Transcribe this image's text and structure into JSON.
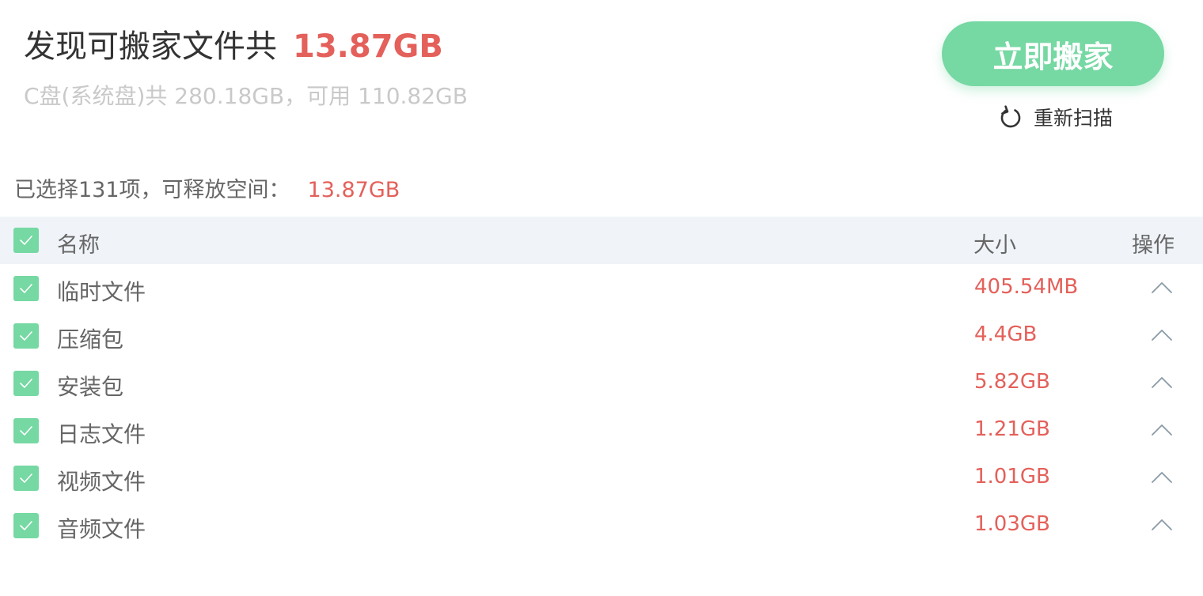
{
  "header": {
    "title": "发现可搬家文件共",
    "total_size": "13.87GB",
    "disk_info": "C盘(系统盘)共 280.18GB，可用 110.82GB",
    "move_button_label": "立即搬家",
    "rescan_label": "重新扫描"
  },
  "summary": {
    "prefix": "已选择131项，可释放空间：",
    "size": "13.87GB"
  },
  "table": {
    "columns": {
      "name": "名称",
      "size": "大小",
      "action": "操作"
    },
    "all_checked": true,
    "rows": [
      {
        "name": "临时文件",
        "size": "405.54MB",
        "checked": true,
        "expanded": false
      },
      {
        "name": "压缩包",
        "size": "4.4GB",
        "checked": true,
        "expanded": false
      },
      {
        "name": "安装包",
        "size": "5.82GB",
        "checked": true,
        "expanded": false
      },
      {
        "name": "日志文件",
        "size": "1.21GB",
        "checked": true,
        "expanded": false
      },
      {
        "name": "视频文件",
        "size": "1.01GB",
        "checked": true,
        "expanded": false
      },
      {
        "name": "音频文件",
        "size": "1.03GB",
        "checked": true,
        "expanded": false
      }
    ]
  },
  "colors": {
    "accent_green": "#76d8a3",
    "size_red": "#e4605a",
    "header_bg": "#f0f4f9"
  },
  "icons": {
    "checkbox": "checkmark-icon",
    "rescan": "refresh-icon",
    "row_toggle": "chevron-up-icon"
  }
}
